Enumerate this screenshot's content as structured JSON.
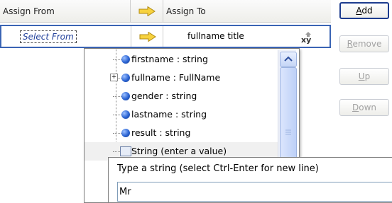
{
  "grid": {
    "header": {
      "assign_from": "Assign From",
      "assign_to": "Assign To"
    },
    "row": {
      "select_from": "Select From",
      "assign_to_value": "fullname title"
    }
  },
  "buttons": {
    "add": {
      "first": "A",
      "rest": "dd"
    },
    "remove": {
      "first": "R",
      "rest": "emove"
    },
    "up": {
      "first": "U",
      "rest": "p"
    },
    "down": {
      "first": "D",
      "rest": "own"
    }
  },
  "tree": {
    "items": [
      {
        "label": "firstname : string"
      },
      {
        "label": "fullname : FullName"
      },
      {
        "label": "gender : string"
      },
      {
        "label": "lastname : string"
      },
      {
        "label": "result : string"
      },
      {
        "label": "String (enter a value)"
      }
    ]
  },
  "editor": {
    "title": "Type a string (select Ctrl-Enter for new line)",
    "value": "Mr"
  },
  "colors": {
    "selection_border": "#3a64b4",
    "arrow_fill": "#f7d23f"
  },
  "icons": {
    "arrow": "arrow-right-icon",
    "xy": "xy-mapping-icon",
    "field": "field-ball-icon"
  }
}
